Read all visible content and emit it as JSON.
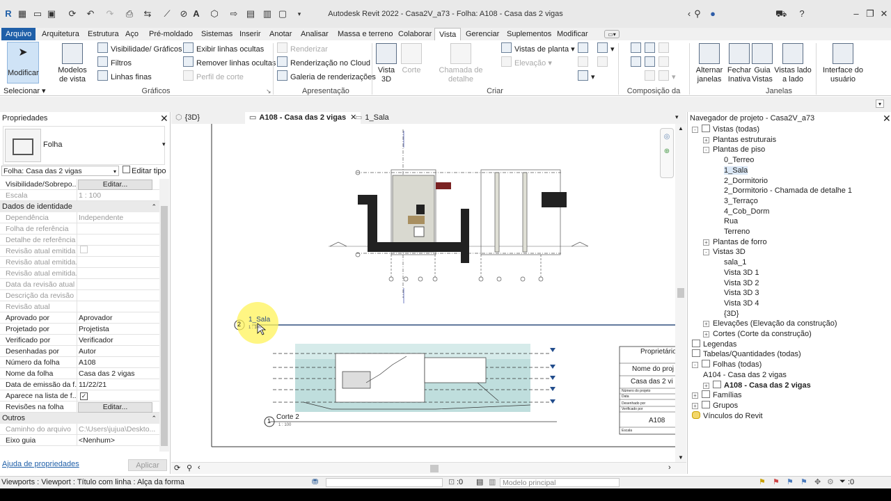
{
  "app": {
    "title": "Autodesk Revit 2022 - Casa2V_a73 - Folha: A108 - Casa das 2 vigas"
  },
  "ribbon_tabs": [
    "Arquivo",
    "Arquitetura",
    "Estrutura",
    "Aço",
    "Pré-moldado",
    "Sistemas",
    "Inserir",
    "Anotar",
    "Analisar",
    "Massa e terreno",
    "Colaborar",
    "Vista",
    "Gerenciar",
    "Suplementos",
    "Modificar"
  ],
  "ribbon": {
    "modificar": "Modificar",
    "selecionar": "Selecionar",
    "modelos_vista": "Modelos de vista",
    "visibilidade": "Visibilidade/ Gráficos",
    "filtros": "Filtros",
    "linhas_finas": "Linhas  finas",
    "exibir_linhas": "Exibir  linhas ocultas",
    "remover_linhas": "Remover  linhas ocultas",
    "perfil_corte": "Perfil  de corte",
    "graficos": "Gráficos",
    "renderizar": "Renderizar",
    "render_cloud": "Renderização  no Cloud",
    "galeria": "Galeria  de renderizações",
    "apresentacao": "Apresentação",
    "vista3d": "Vista 3D",
    "corte": "Corte",
    "chamada": "Chamada de detalhe",
    "vistas_planta": "Vistas de  planta",
    "elevacao": "Elevação",
    "criar": "Criar",
    "composicao": "Composição da folha",
    "alternar": "Alternar janelas",
    "fechar": "Fechar Inativa",
    "guia": "Guia Vistas",
    "lado": "Vistas lado a lado",
    "interface": "Interface do usuário",
    "janelas": "Janelas"
  },
  "properties": {
    "title": "Propriedades",
    "type": "Folha",
    "selector": "Folha: Casa das 2 vigas",
    "edit_type": "Editar tipo",
    "rows_top": [
      {
        "k": "Visibilidade/Sobrepo...",
        "v": "Editar..."
      },
      {
        "k": "Escala",
        "v": "1 : 100"
      }
    ],
    "group_identity": "Dados de identidade",
    "rows_identity": [
      {
        "k": "Dependência",
        "v": "Independente"
      },
      {
        "k": "Folha de referência",
        "v": ""
      },
      {
        "k": "Detalhe de referência",
        "v": ""
      },
      {
        "k": "Revisão atual emitida",
        "v": ""
      },
      {
        "k": "Revisão atual emitida...",
        "v": ""
      },
      {
        "k": "Revisão atual emitida...",
        "v": ""
      },
      {
        "k": "Data da revisão atual",
        "v": ""
      },
      {
        "k": "Descrição da revisão ...",
        "v": ""
      },
      {
        "k": "Revisão atual",
        "v": ""
      },
      {
        "k": "Aprovado por",
        "v": "Aprovador"
      },
      {
        "k": "Projetado por",
        "v": "Projetista"
      },
      {
        "k": "Verificado por",
        "v": "Verificador"
      },
      {
        "k": "Desenhadas por",
        "v": "Autor"
      },
      {
        "k": "Número da folha",
        "v": "A108"
      },
      {
        "k": "Nome da folha",
        "v": "Casa das 2 vigas"
      },
      {
        "k": "Data de emissão da f...",
        "v": "11/22/21"
      },
      {
        "k": "Aparece na lista de f...",
        "v": ""
      },
      {
        "k": "Revisões na folha",
        "v": "Editar..."
      }
    ],
    "group_outros": "Outros",
    "rows_outros": [
      {
        "k": "Caminho do arquivo",
        "v": "C:\\Users\\jujua\\Deskto..."
      },
      {
        "k": "Eixo guia",
        "v": "<Nenhum>"
      }
    ],
    "help": "Ajuda de propriedades",
    "apply": "Aplicar"
  },
  "view_tabs": [
    "{3D}",
    "A108 - Casa das 2 vigas",
    "1_Sala"
  ],
  "sheet": {
    "view_num_2": "2",
    "view_label_2": "1_Sala",
    "view_num_1": "1",
    "view_label_1": "Corte 2",
    "scale": "1 : 100",
    "tb_owner": "Proprietário",
    "tb_proj": "Nome do proj",
    "tb_name": "Casa das 2 vi",
    "tb_num": "Número do projeto",
    "tb_date": "Data",
    "tb_desenhado": "Desenhado por",
    "tb_verificado": "Verificado por",
    "tb_sheet": "A108",
    "tb_escala": "Escala"
  },
  "browser": {
    "title": "Navegador de projeto - Casa2V_a73",
    "items": [
      {
        "t": "Vistas (todas)",
        "l": 0,
        "tog": "-"
      },
      {
        "t": "Plantas estruturais",
        "l": 1,
        "tog": "+"
      },
      {
        "t": "Plantas de piso",
        "l": 1,
        "tog": "-"
      },
      {
        "t": "0_Terreo",
        "l": 2,
        "tog": ""
      },
      {
        "t": "1_Sala",
        "l": 2,
        "tog": "",
        "sel": true
      },
      {
        "t": "2_Dormitorio",
        "l": 2,
        "tog": ""
      },
      {
        "t": "2_Dormitorio - Chamada de detalhe 1",
        "l": 2,
        "tog": ""
      },
      {
        "t": "3_Terraço",
        "l": 2,
        "tog": ""
      },
      {
        "t": "4_Cob_Dorm",
        "l": 2,
        "tog": ""
      },
      {
        "t": "Rua",
        "l": 2,
        "tog": ""
      },
      {
        "t": "Terreno",
        "l": 2,
        "tog": ""
      },
      {
        "t": "Plantas de forro",
        "l": 1,
        "tog": "+"
      },
      {
        "t": "Vistas 3D",
        "l": 1,
        "tog": "-"
      },
      {
        "t": "sala_1",
        "l": 2,
        "tog": ""
      },
      {
        "t": "Vista 3D 1",
        "l": 2,
        "tog": ""
      },
      {
        "t": "Vista 3D 2",
        "l": 2,
        "tog": ""
      },
      {
        "t": "Vista 3D 3",
        "l": 2,
        "tog": ""
      },
      {
        "t": "Vista 3D 4",
        "l": 2,
        "tog": ""
      },
      {
        "t": "{3D}",
        "l": 2,
        "tog": ""
      },
      {
        "t": "Elevações (Elevação da construção)",
        "l": 1,
        "tog": "+"
      },
      {
        "t": "Cortes (Corte da construção)",
        "l": 1,
        "tog": "+"
      },
      {
        "t": "Legendas",
        "l": 0,
        "tog": ""
      },
      {
        "t": "Tabelas/Quantidades (todas)",
        "l": 0,
        "tog": ""
      },
      {
        "t": "Folhas (todas)",
        "l": 0,
        "tog": "-"
      },
      {
        "t": "A104 - Casa das 2 vigas",
        "l": 1,
        "tog": ""
      },
      {
        "t": "A108 - Casa das 2 vigas",
        "l": 1,
        "tog": "+",
        "bold": true
      },
      {
        "t": "Famílias",
        "l": 0,
        "tog": "+"
      },
      {
        "t": "Grupos",
        "l": 0,
        "tog": "+"
      },
      {
        "t": "Vínculos do Revit",
        "l": 0,
        "tog": ""
      }
    ]
  },
  "status": {
    "text": "Viewports : Viewport : Título com linha : Alça da forma",
    "zero1": ":0",
    "model": "Modelo principal",
    "zero2": ":0"
  }
}
